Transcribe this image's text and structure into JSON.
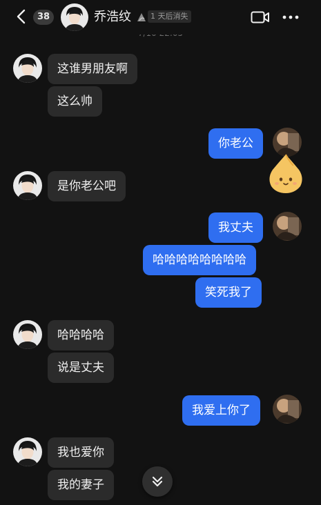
{
  "header": {
    "unread_count": "38",
    "contact_name": "乔浩纹",
    "expire_label": "1 天后消失",
    "icons": [
      "back-arrow-icon",
      "timer-icon",
      "video-call-icon",
      "more-icon"
    ]
  },
  "timestamp": "7/10 22:05",
  "messages": [
    {
      "from": "contact",
      "text": "这谁男朋友啊"
    },
    {
      "from": "contact",
      "text": "这么帅"
    },
    {
      "from": "me",
      "text": "你老公"
    },
    {
      "from": "me",
      "sticker": "yellow-blob-sticker"
    },
    {
      "from": "contact",
      "text": "是你老公吧"
    },
    {
      "from": "me",
      "text": "我丈夫"
    },
    {
      "from": "me",
      "text": "哈哈哈哈哈哈哈哈"
    },
    {
      "from": "me",
      "text": "笑死我了"
    },
    {
      "from": "contact",
      "text": "哈哈哈哈"
    },
    {
      "from": "contact",
      "text": "说是丈夫"
    },
    {
      "from": "me",
      "text": "我爱上你了"
    },
    {
      "from": "contact",
      "text": "我也爱你"
    },
    {
      "from": "contact",
      "text": "我的妻子"
    }
  ],
  "colors": {
    "background": "#121212",
    "incoming_bubble": "#2b2b2b",
    "outgoing_bubble": "#2f6ef0",
    "text": "#ffffff"
  }
}
